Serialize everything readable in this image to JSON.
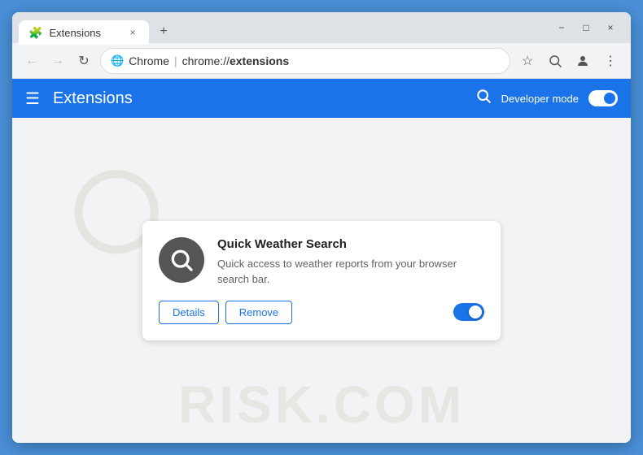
{
  "browser": {
    "tab": {
      "title": "Extensions",
      "close_label": "×",
      "new_tab_label": "+"
    },
    "window_controls": {
      "minimize": "−",
      "maximize": "□",
      "close": "×"
    },
    "address_bar": {
      "domain": "Chrome",
      "separator": "|",
      "url": "chrome://extensions"
    },
    "nav": {
      "back": "←",
      "forward": "→",
      "reload": "↻"
    }
  },
  "header": {
    "menu_icon": "☰",
    "title": "Extensions",
    "search_icon": "🔍",
    "dev_mode_label": "Developer mode",
    "toggle_state": "on"
  },
  "extension": {
    "name": "Quick Weather Search",
    "description": "Quick access to weather reports from your browser search bar.",
    "details_btn": "Details",
    "remove_btn": "Remove",
    "enabled": true
  },
  "watermark": {
    "text": "RISK.COM"
  },
  "colors": {
    "blue": "#1a73e8",
    "header_bg": "#1a73e8",
    "tab_bar": "#dee1e6",
    "page_bg": "#f1f3f4"
  }
}
